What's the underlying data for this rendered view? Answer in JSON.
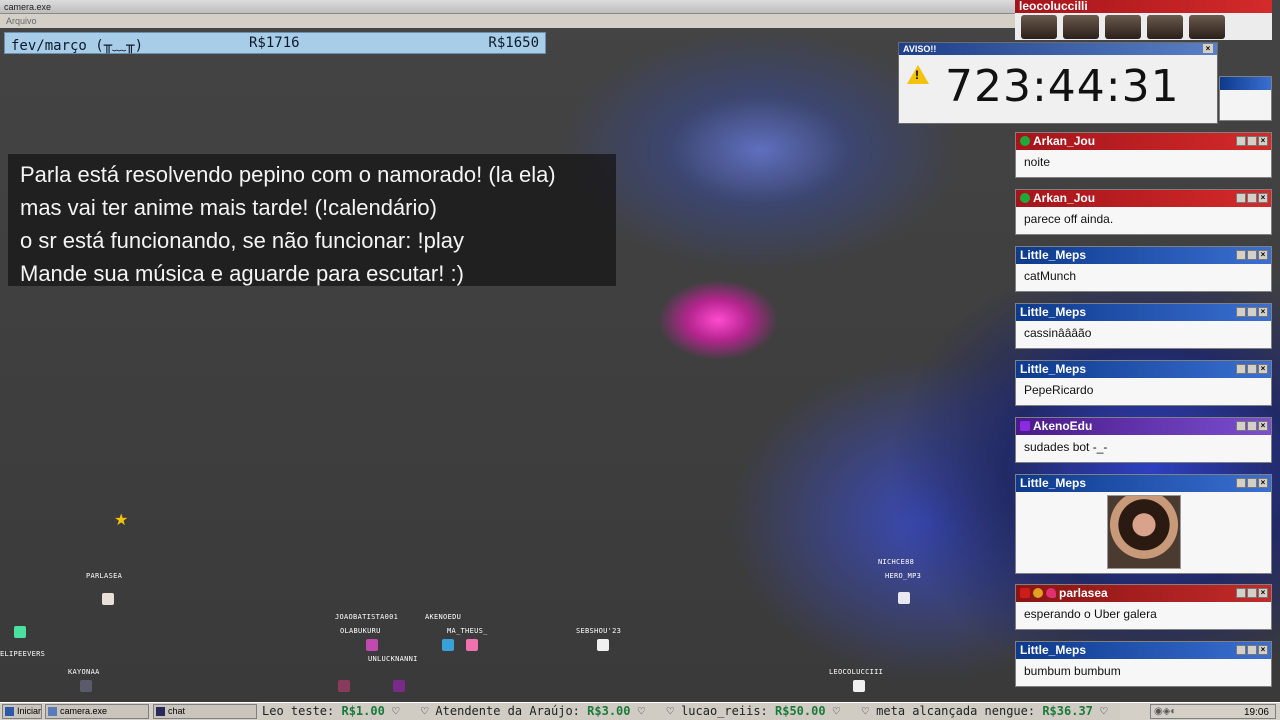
{
  "window": {
    "title": "camera.exe",
    "menu": "Arquivo"
  },
  "goal_bar": {
    "label": "fev/março (╥﹏╥)",
    "current": "R$1716",
    "target": "R$1650"
  },
  "info_box": {
    "lines": [
      "Parla está resolvendo pepino com o namorado! (la ela)",
      "mas vai ter anime mais tarde! (!calendário)",
      "o sr está funcionando, se não funcionar: !play",
      "Mande sua música e aguarde para escutar! :)"
    ]
  },
  "alert": {
    "title": "AVISO!!",
    "timer": "723:44:31",
    "icon": "warning-icon"
  },
  "webcam": {
    "user": "leocoluccilli"
  },
  "chat": [
    {
      "user": "Arkan_Jou",
      "message": "noite",
      "badge": "green",
      "color": "red"
    },
    {
      "user": "Arkan_Jou",
      "message": "parece off ainda.",
      "badge": "green",
      "color": "red"
    },
    {
      "user": "Little_Meps",
      "message": "catMunch",
      "badge": "",
      "color": "blue"
    },
    {
      "user": "Little_Meps",
      "message": "cassinâââão",
      "badge": "",
      "color": "blue"
    },
    {
      "user": "Little_Meps",
      "message": "PepeRicardo",
      "badge": "",
      "color": "blue"
    },
    {
      "user": "AkenoEdu",
      "message": "sudades bot -_-",
      "badge": "purple",
      "color": "purple"
    },
    {
      "user": "Little_Meps",
      "message": "",
      "badge": "",
      "color": "blue",
      "image": "photo"
    },
    {
      "user": "parlasea",
      "message": "esperando o Uber galera",
      "badge": "red",
      "color": "dkred"
    },
    {
      "user": "Little_Meps",
      "message": "bumbum bumbum",
      "badge": "",
      "color": "blue"
    }
  ],
  "sprites": [
    {
      "name": "PARLASEA"
    },
    {
      "name": "ELIPEEVERS"
    },
    {
      "name": "KAYONAA"
    },
    {
      "name": "JOAOBATISTA001"
    },
    {
      "name": "OLABUKURU"
    },
    {
      "name": "UNLUCKNANNI"
    },
    {
      "name": "AKENOEDU"
    },
    {
      "name": "MA_THEUS_"
    },
    {
      "name": "SEBSHOU'23"
    },
    {
      "name": "NICHCE88"
    },
    {
      "name": "HERO_MP3"
    },
    {
      "name": "LEOCOLUCCIII"
    }
  ],
  "taskbar": {
    "start": "Iniciar",
    "apps": [
      "camera.exe",
      "chat"
    ],
    "ticker": [
      {
        "text": "Leo teste: ",
        "amount": "R$1.00"
      },
      {
        "text": "♡ Atendente da Araújo: ",
        "amount": "R$3.00"
      },
      {
        "text": "♡ lucao_reiis: ",
        "amount": "R$50.00"
      },
      {
        "text": "♡ meta alcançada nengue: ",
        "amount": "R$36.37"
      }
    ],
    "clock": "19:06"
  },
  "colors": {
    "goal_bar": "#a8cde8",
    "chat_red": "#c42020",
    "chat_blue": "#1a4aa8",
    "donation_green": "#1a7a3a"
  }
}
